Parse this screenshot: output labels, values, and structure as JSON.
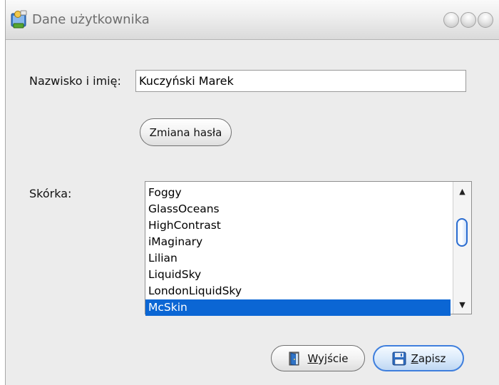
{
  "window": {
    "title": "Dane użytkownika",
    "icon": "user-card-icon"
  },
  "form": {
    "name_label": "Nazwisko i imię:",
    "name_value": "Kuczyński Marek",
    "change_password_label": "Zmiana hasła",
    "skin_label": "Skórka:"
  },
  "skins": {
    "items": [
      "Foggy",
      "GlassOceans",
      "HighContrast",
      "iMaginary",
      "Lilian",
      "LiquidSky",
      "LondonLiquidSky",
      "McSkin"
    ],
    "selected": "McSkin"
  },
  "buttons": {
    "exit_accel": "W",
    "exit_rest": "yjście",
    "exit_icon": "door-exit-icon",
    "save_accel": "Z",
    "save_rest": "apisz",
    "save_icon": "floppy-disk-icon"
  },
  "colors": {
    "selection": "#0b66d4",
    "focus_border": "#3f7fdd"
  }
}
